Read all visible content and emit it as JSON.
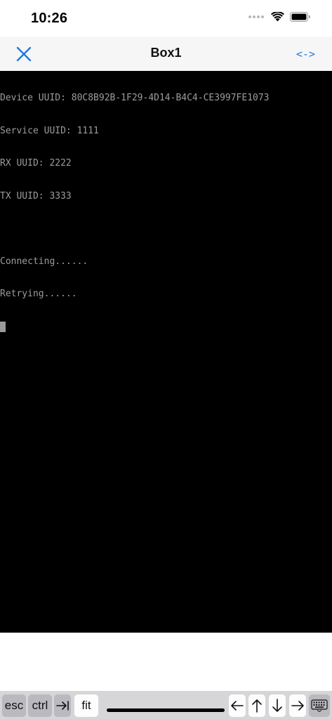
{
  "status_bar": {
    "time": "10:26",
    "icons": [
      "cellular-dots-icon",
      "wifi-icon",
      "battery-icon"
    ]
  },
  "nav": {
    "title": "Box1",
    "close_icon": "close-x-icon",
    "swap_label": "<->"
  },
  "terminal": {
    "lines": [
      "Device UUID: 80C8B92B-1F29-4D14-B4C4-CE3997FE1073",
      "Service UUID: 1111",
      "RX UUID: 2222",
      "TX UUID: 3333",
      "",
      "Connecting......",
      "Retrying......"
    ]
  },
  "keyboard_bar": {
    "esc": "esc",
    "ctrl": "ctrl",
    "tab_icon": "tab-arrow-icon",
    "fit": "fit",
    "arrows": [
      "arrow-left-icon",
      "arrow-up-icon",
      "arrow-down-icon",
      "arrow-right-icon"
    ],
    "keyboard_icon": "keyboard-icon"
  },
  "colors": {
    "accent": "#1f7ae0",
    "terminal_bg": "#000000",
    "terminal_text": "#9c9c9c",
    "nav_bg": "#f6f6f6",
    "key_bar_bg": "#d6d6d9"
  }
}
